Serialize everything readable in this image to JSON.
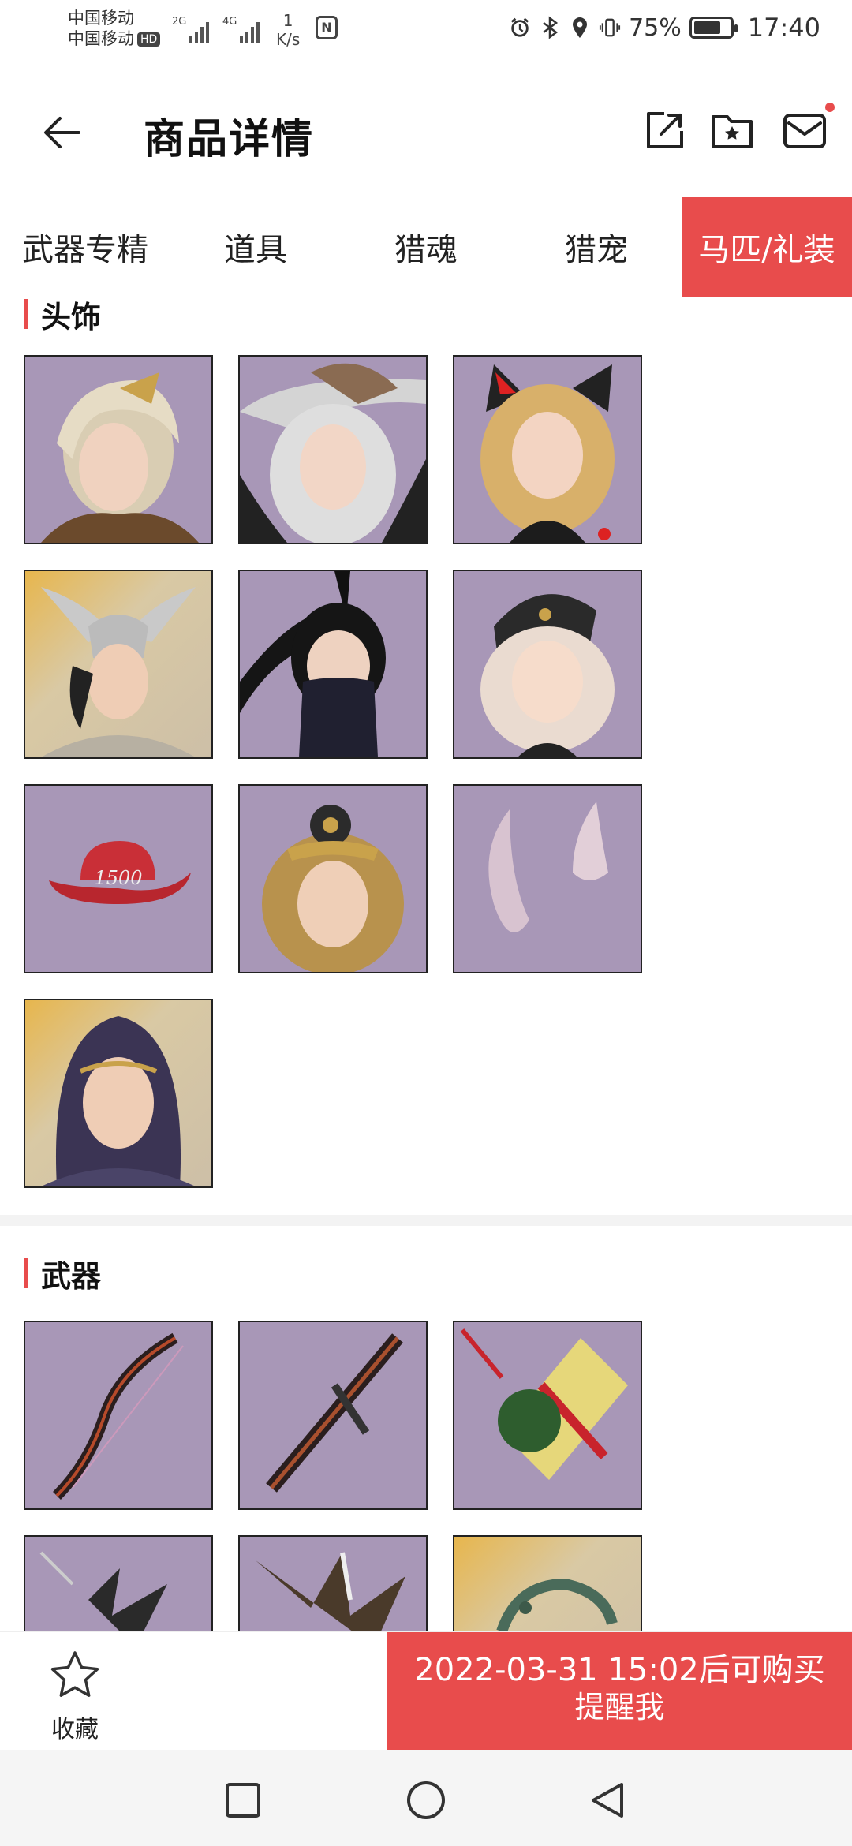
{
  "status": {
    "carrier1": "中国移动",
    "carrier2": "中国移动",
    "hd": "HD",
    "sig1_label": "2G",
    "sig2_label": "4G",
    "net_speed_value": "1",
    "net_speed_unit": "K/s",
    "nfc": "N",
    "battery_pct": "75%",
    "battery_level": 0.75,
    "time": "17:40",
    "icons": [
      "alarm-icon",
      "bluetooth-icon",
      "location-icon",
      "vibrate-icon"
    ]
  },
  "appbar": {
    "title": "商品详情",
    "icons": [
      "back-arrow-icon",
      "share-icon",
      "folder-star-icon",
      "mail-icon"
    ],
    "accent": "#e84c4c"
  },
  "tabs": [
    {
      "label": "武器专精",
      "active": false
    },
    {
      "label": "道具",
      "active": false
    },
    {
      "label": "猎魂",
      "active": false
    },
    {
      "label": "猎宠",
      "active": false
    },
    {
      "label": "马匹/礼装",
      "active": true
    }
  ],
  "sections": [
    {
      "title": "头饰",
      "items": [
        {
          "name": "laurel-hair-headwear"
        },
        {
          "name": "white-hat-headwear"
        },
        {
          "name": "cat-ear-headwear"
        },
        {
          "name": "winged-helmet-headwear"
        },
        {
          "name": "ninja-mask-headwear"
        },
        {
          "name": "military-cap-headwear"
        },
        {
          "name": "red-cowboy-hat-headwear",
          "text": "1500"
        },
        {
          "name": "flower-crown-headwear"
        },
        {
          "name": "horn-ears-headwear"
        },
        {
          "name": "hooded-circlet-headwear"
        }
      ]
    },
    {
      "title": "武器",
      "items": [
        {
          "name": "dark-bow-weapon"
        },
        {
          "name": "dark-crossbow-weapon"
        },
        {
          "name": "christmas-gift-weapon"
        },
        {
          "name": "spiked-blade-weapon"
        },
        {
          "name": "spiked-axe-weapon"
        },
        {
          "name": "serpent-blade-weapon"
        }
      ]
    }
  ],
  "bottom": {
    "fav_label": "收藏",
    "buy_line1": "2022-03-31 15:02后可购买",
    "buy_line2": "提醒我"
  },
  "navbar": {
    "icons": [
      "recent-apps-icon",
      "home-icon",
      "back-icon"
    ]
  }
}
